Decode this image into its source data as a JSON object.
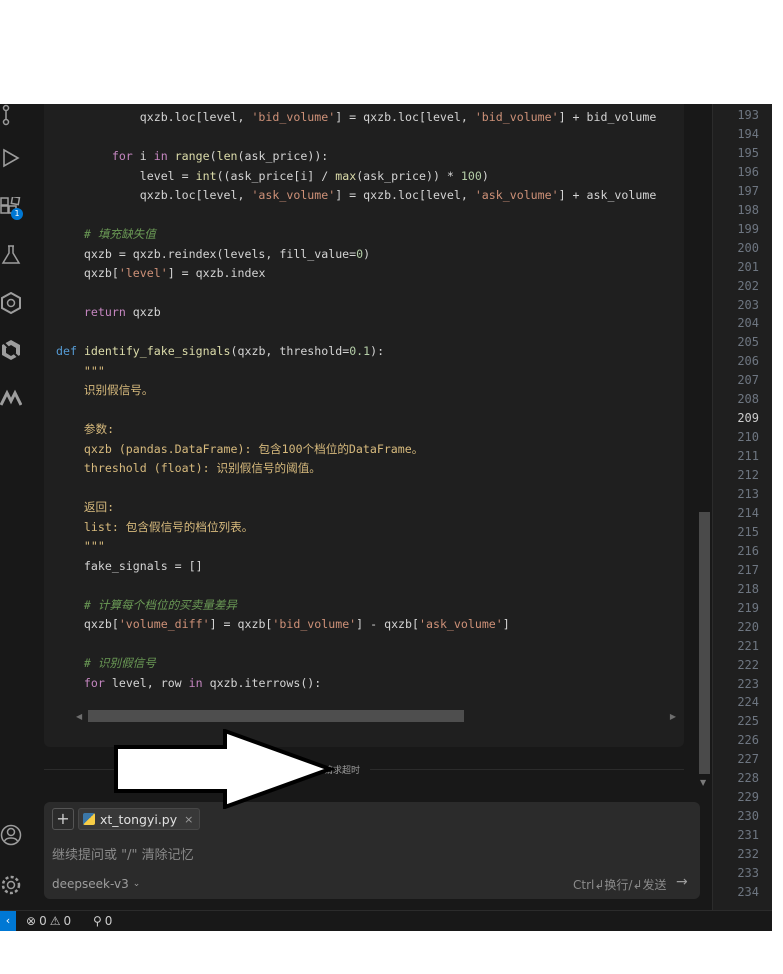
{
  "code_lines": [
    [
      {
        "t": "            qxzb.loc[level, ",
        "c": "var"
      },
      {
        "t": "'bid_volume'",
        "c": "str"
      },
      {
        "t": "] = qxzb.loc[level, ",
        "c": "var"
      },
      {
        "t": "'bid_volume'",
        "c": "str"
      },
      {
        "t": "] + bid_volume",
        "c": "var"
      }
    ],
    [
      {
        "t": "",
        "c": "var"
      }
    ],
    [
      {
        "t": "        ",
        "c": "var"
      },
      {
        "t": "for",
        "c": "kw2"
      },
      {
        "t": " i ",
        "c": "var"
      },
      {
        "t": "in",
        "c": "kw2"
      },
      {
        "t": " ",
        "c": "var"
      },
      {
        "t": "range",
        "c": "fn"
      },
      {
        "t": "(",
        "c": "var"
      },
      {
        "t": "len",
        "c": "fn"
      },
      {
        "t": "(ask_price)):",
        "c": "var"
      }
    ],
    [
      {
        "t": "            level = ",
        "c": "var"
      },
      {
        "t": "int",
        "c": "fn"
      },
      {
        "t": "((ask_price[i] / ",
        "c": "var"
      },
      {
        "t": "max",
        "c": "fn"
      },
      {
        "t": "(ask_price)) * ",
        "c": "var"
      },
      {
        "t": "100",
        "c": "num"
      },
      {
        "t": ")",
        "c": "var"
      }
    ],
    [
      {
        "t": "            qxzb.loc[level, ",
        "c": "var"
      },
      {
        "t": "'ask_volume'",
        "c": "str"
      },
      {
        "t": "] = qxzb.loc[level, ",
        "c": "var"
      },
      {
        "t": "'ask_volume'",
        "c": "str"
      },
      {
        "t": "] + ask_volume",
        "c": "var"
      }
    ],
    [
      {
        "t": "",
        "c": "var"
      }
    ],
    [
      {
        "t": "    ",
        "c": "var"
      },
      {
        "t": "# 填充缺失值",
        "c": "cm"
      }
    ],
    [
      {
        "t": "    qxzb = qxzb.reindex(levels, fill_value=",
        "c": "var"
      },
      {
        "t": "0",
        "c": "num"
      },
      {
        "t": ")",
        "c": "var"
      }
    ],
    [
      {
        "t": "    qxzb[",
        "c": "var"
      },
      {
        "t": "'level'",
        "c": "str"
      },
      {
        "t": "] = qxzb.index",
        "c": "var"
      }
    ],
    [
      {
        "t": "",
        "c": "var"
      }
    ],
    [
      {
        "t": "    ",
        "c": "var"
      },
      {
        "t": "return",
        "c": "kw2"
      },
      {
        "t": " qxzb",
        "c": "var"
      }
    ],
    [
      {
        "t": "",
        "c": "var"
      }
    ],
    [
      {
        "t": "def",
        "c": "kw"
      },
      {
        "t": " ",
        "c": "var"
      },
      {
        "t": "identify_fake_signals",
        "c": "fn"
      },
      {
        "t": "(qxzb, threshold=",
        "c": "var"
      },
      {
        "t": "0.1",
        "c": "num"
      },
      {
        "t": "):",
        "c": "var"
      }
    ],
    [
      {
        "t": "    \"\"\"",
        "c": "docg"
      }
    ],
    [
      {
        "t": "    识别假信号。",
        "c": "docg"
      }
    ],
    [
      {
        "t": "",
        "c": "var"
      }
    ],
    [
      {
        "t": "    参数:",
        "c": "docg"
      }
    ],
    [
      {
        "t": "    qxzb (pandas.DataFrame): 包含100个档位的DataFrame。",
        "c": "docg"
      }
    ],
    [
      {
        "t": "    threshold (float): 识别假信号的阈值。",
        "c": "docg"
      }
    ],
    [
      {
        "t": "",
        "c": "var"
      }
    ],
    [
      {
        "t": "    返回:",
        "c": "docg"
      }
    ],
    [
      {
        "t": "    list: 包含假信号的档位列表。",
        "c": "docg"
      }
    ],
    [
      {
        "t": "    \"\"\"",
        "c": "docg"
      }
    ],
    [
      {
        "t": "    fake_signals = []",
        "c": "var"
      }
    ],
    [
      {
        "t": "",
        "c": "var"
      }
    ],
    [
      {
        "t": "    ",
        "c": "var"
      },
      {
        "t": "# 计算每个档位的买卖量差异",
        "c": "cm"
      }
    ],
    [
      {
        "t": "    qxzb[",
        "c": "var"
      },
      {
        "t": "'volume_diff'",
        "c": "str"
      },
      {
        "t": "] = qxzb[",
        "c": "var"
      },
      {
        "t": "'bid_volume'",
        "c": "str"
      },
      {
        "t": "] - qxzb[",
        "c": "var"
      },
      {
        "t": "'ask_volume'",
        "c": "str"
      },
      {
        "t": "]",
        "c": "var"
      }
    ],
    [
      {
        "t": "",
        "c": "var"
      }
    ],
    [
      {
        "t": "    ",
        "c": "var"
      },
      {
        "t": "# 识别假信号",
        "c": "cm"
      }
    ],
    [
      {
        "t": "    ",
        "c": "var"
      },
      {
        "t": "for",
        "c": "kw2"
      },
      {
        "t": " level, row ",
        "c": "var"
      },
      {
        "t": "in",
        "c": "kw2"
      },
      {
        "t": " qxzb.iterrows():",
        "c": "var"
      }
    ]
  ],
  "activity_badge": "1",
  "timeout_text": "请求超时",
  "input": {
    "file_chip": "xt_tongyi.py",
    "file_chip_close": "×",
    "placeholder": "继续提问或 \"/\" 清除记忆",
    "model": "deepseek-v3",
    "send_hint": "Ctrl↲换行/↲发送",
    "send_arrow": "→",
    "plus": "+"
  },
  "line_numbers": [
    "193",
    "194",
    "195",
    "196",
    "197",
    "198",
    "199",
    "200",
    "201",
    "202",
    "203",
    "204",
    "205",
    "206",
    "207",
    "208",
    "209",
    "210",
    "211",
    "212",
    "213",
    "214",
    "215",
    "216",
    "217",
    "218",
    "219",
    "220",
    "221",
    "222",
    "223",
    "224",
    "225",
    "226",
    "227",
    "228",
    "229",
    "230",
    "231",
    "232",
    "233",
    "234"
  ],
  "active_line": "209",
  "status": {
    "errors": "0",
    "warnings": "0",
    "ports": "0"
  },
  "colors": {
    "accent": "#0078d4",
    "background": "#181818"
  }
}
